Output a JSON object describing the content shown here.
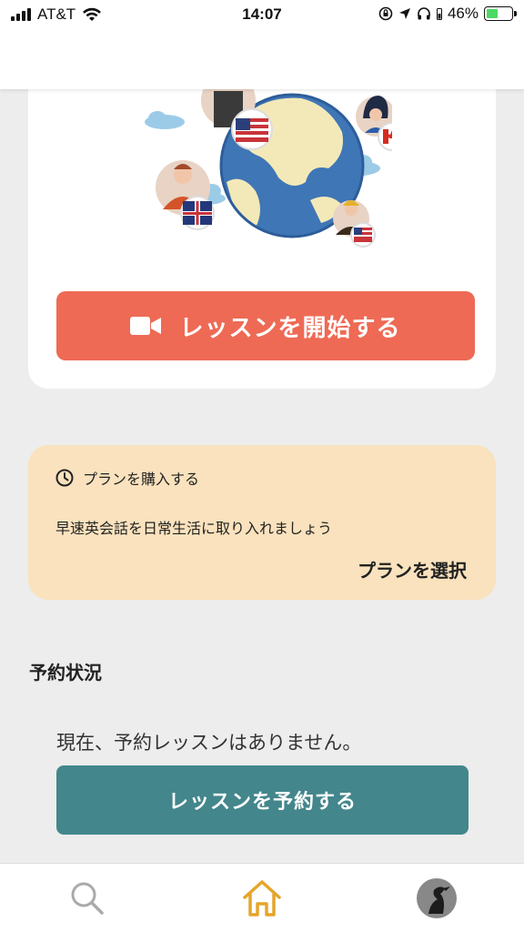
{
  "status_bar": {
    "carrier": "AT&T",
    "time": "14:07",
    "battery": "46%",
    "battery_level": 0.46
  },
  "lesson": {
    "start_button_label": "レッスンを開始する",
    "start_button_icon": "video-camera-icon",
    "illustration_icons": [
      "globe",
      "flag-usa",
      "flag-canada",
      "flag-uk"
    ]
  },
  "plan": {
    "title": "プランを購入する",
    "title_icon": "clock-icon",
    "description": "早速英会話を日常生活に取り入れましょう",
    "select_label": "プランを選択"
  },
  "reservation": {
    "title": "予約状況",
    "empty_message": "現在、予約レッスンはありません。",
    "reserve_button_label": "レッスンを予約する"
  },
  "tab_bar": {
    "tabs": [
      {
        "icon": "search-icon",
        "active": false
      },
      {
        "icon": "home-icon",
        "active": true
      },
      {
        "icon": "profile-avatar",
        "active": false
      }
    ]
  },
  "colors": {
    "start_button": "#ee6a55",
    "plan_card": "#f9e2bd",
    "reserve_button": "#43868b",
    "home_active": "#e5a52a"
  }
}
